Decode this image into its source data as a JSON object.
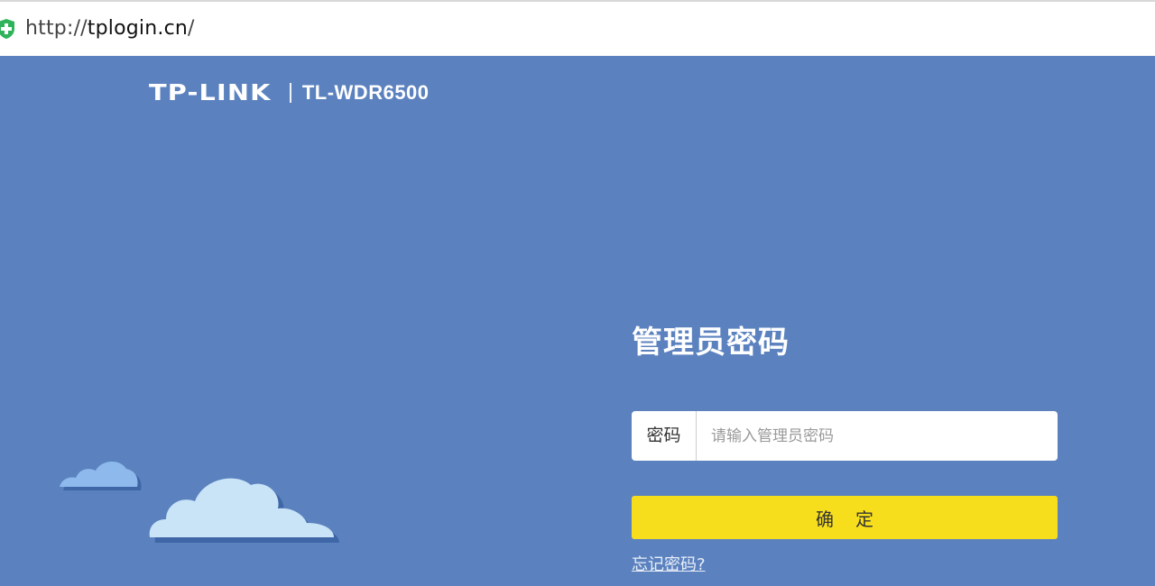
{
  "browser": {
    "url_scheme": "http://",
    "url_domain": "tplogin.cn",
    "url_suffix": "/"
  },
  "brand": {
    "logo_text": "TP-LINK",
    "model": "TL-WDR6500"
  },
  "login": {
    "title": "管理员密码",
    "password_label": "密码",
    "password_placeholder": "请输入管理员密码",
    "password_value": "",
    "confirm_label": "确定",
    "forgot_link": "忘记密码?"
  },
  "colors": {
    "background": "#5b82bf",
    "button": "#f7de1d",
    "cloud_light": "#c9e4f7",
    "cloud_dark": "#8db9ec"
  }
}
